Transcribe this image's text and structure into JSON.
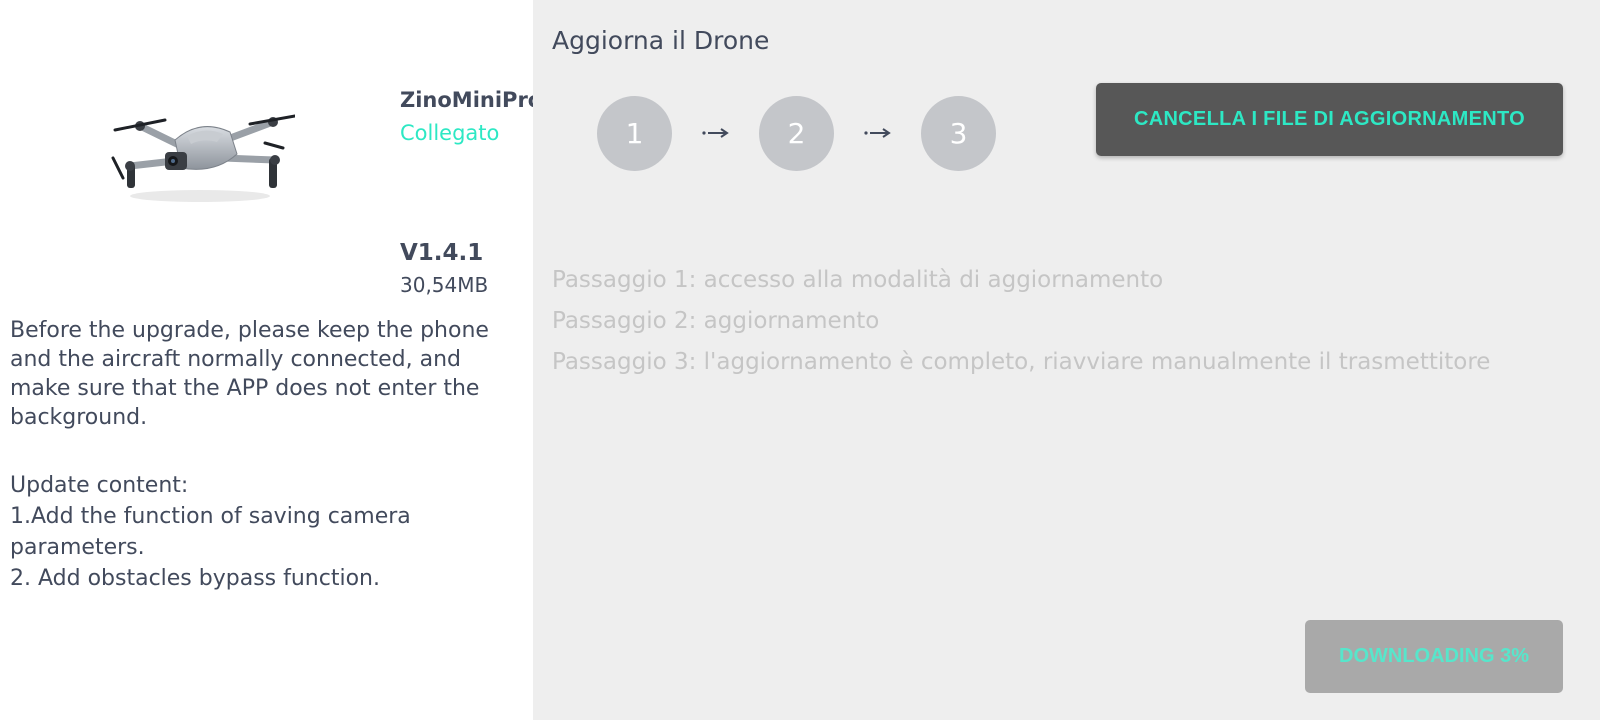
{
  "device": {
    "name": "ZinoMiniPro",
    "status": "Collegato",
    "status_color": "#2de8c4"
  },
  "firmware": {
    "version": "V1.4.1",
    "size": "30,54MB"
  },
  "notes": {
    "warning": "Before the upgrade, please keep the phone and the aircraft normally connected, and make sure that the APP does not enter the background.",
    "lines": [
      "Update content:",
      "1.Add the function of saving camera parameters.",
      "2. Add obstacles bypass function."
    ]
  },
  "update": {
    "title": "Aggiorna il Drone",
    "steps": [
      "1",
      "2",
      "3"
    ],
    "clear_button": "CANCELLA I FILE DI AGGIORNAMENTO",
    "descriptions": [
      "Passaggio 1: accesso alla modalità di aggiornamento",
      "Passaggio 2: aggiornamento",
      "Passaggio 3: l'aggiornamento è completo, riavviare manualmente il trasmettitore"
    ],
    "download_button": "DOWNLOADING 3%",
    "download_progress_percent": 3
  },
  "icons": {
    "drone": "drone-image",
    "arrow": "arrow-right-icon"
  },
  "colors": {
    "accent": "#2de8c4",
    "step_circle": "#c4c6ca",
    "clear_button_bg": "#575757",
    "download_button_bg": "#a9a9a9"
  }
}
